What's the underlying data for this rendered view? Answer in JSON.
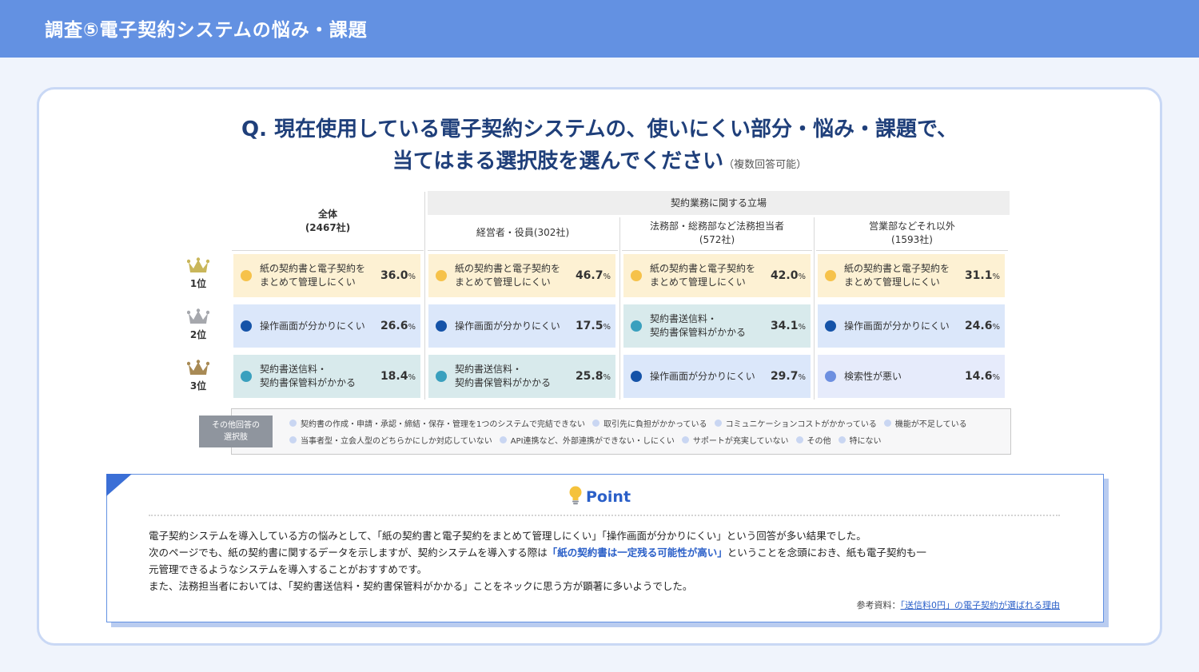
{
  "header": {
    "title": "調査⑤電子契約システムの悩み・課題"
  },
  "question": {
    "line1": "Q. 現在使用している電子契約システムの、使いにくい部分・悩み・課題で、",
    "line2": "当てはまる選択肢を選んでください",
    "note": "（複数回答可能）"
  },
  "table": {
    "all_header": {
      "name": "全体",
      "count": "(2467社)"
    },
    "group_header": "契約業務に関する立場",
    "columns": [
      {
        "name": "経営者・役員(302社)",
        "count": ""
      },
      {
        "name": "法務部・総務部など法務担当者",
        "count": "(572社)"
      },
      {
        "name": "営業部などそれ以外",
        "count": "(1593社)"
      }
    ],
    "ranks": [
      "1位",
      "2位",
      "3位"
    ],
    "cells": [
      [
        {
          "line1": "紙の契約書と電子契約を",
          "line2": "まとめて管理しにくい",
          "value": "36.0",
          "unit": "%",
          "bg": "#fdf1d3",
          "dot": "#f6c24a"
        },
        {
          "line1": "紙の契約書と電子契約を",
          "line2": "まとめて管理しにくい",
          "value": "46.7",
          "unit": "%",
          "bg": "#fdf1d3",
          "dot": "#f6c24a"
        },
        {
          "line1": "紙の契約書と電子契約を",
          "line2": "まとめて管理しにくい",
          "value": "42.0",
          "unit": "%",
          "bg": "#fdf1d3",
          "dot": "#f6c24a"
        },
        {
          "line1": "紙の契約書と電子契約を",
          "line2": "まとめて管理しにくい",
          "value": "31.1",
          "unit": "%",
          "bg": "#fdf1d3",
          "dot": "#f6c24a"
        }
      ],
      [
        {
          "line1": "操作画面が分かりにくい",
          "line2": "",
          "value": "26.6",
          "unit": "%",
          "bg": "#dbe7fa",
          "dot": "#1553a8"
        },
        {
          "line1": "操作画面が分かりにくい",
          "line2": "",
          "value": "17.5",
          "unit": "%",
          "bg": "#dbe7fa",
          "dot": "#1553a8"
        },
        {
          "line1": "契約書送信料・",
          "line2": "契約書保管料がかかる",
          "value": "34.1",
          "unit": "%",
          "bg": "#d8eaec",
          "dot": "#3aa0be"
        },
        {
          "line1": "操作画面が分かりにくい",
          "line2": "",
          "value": "24.6",
          "unit": "%",
          "bg": "#dbe7fa",
          "dot": "#1553a8"
        }
      ],
      [
        {
          "line1": "契約書送信料・",
          "line2": "契約書保管料がかかる",
          "value": "18.4",
          "unit": "%",
          "bg": "#d8eaec",
          "dot": "#3aa0be"
        },
        {
          "line1": "契約書送信料・",
          "line2": "契約書保管料がかかる",
          "value": "25.8",
          "unit": "%",
          "bg": "#d8eaec",
          "dot": "#3aa0be"
        },
        {
          "line1": "操作画面が分かりにくい",
          "line2": "",
          "value": "29.7",
          "unit": "%",
          "bg": "#dbe7fa",
          "dot": "#1553a8"
        },
        {
          "line1": "検索性が悪い",
          "line2": "",
          "value": "14.6",
          "unit": "%",
          "bg": "#e6ebfb",
          "dot": "#6d8fe0"
        }
      ]
    ]
  },
  "others": {
    "tag_line1": "その他回答の",
    "tag_line2": "選択肢",
    "row1": [
      "契約書の作成・申請・承認・締結・保存・管理を1つのシステムで完結できない",
      "取引先に負担がかかっている",
      "コミュニケーションコストがかかっている",
      "機能が不足している"
    ],
    "row2": [
      "当事者型・立会人型のどちらかにしか対応していない",
      "API連携など、外部連携ができない・しにくい",
      "サポートが充実していない",
      "その他",
      "特にない"
    ]
  },
  "point": {
    "title": "Point",
    "p1": "電子契約システムを導入している方の悩みとして、「紙の契約書と電子契約をまとめて管理しにくい」「操作画面が分かりにくい」という回答が多い結果でした。",
    "p2_pre": "次のページでも、紙の契約書に関するデータを示しますが、契約システムを導入する際は",
    "p2_hl": "「紙の契約書は一定残る可能性が高い」",
    "p2_post": "ということを念頭におき、紙も電子契約も一",
    "p3": "元管理できるようなシステムを導入することがおすすめです。",
    "p4": "また、法務担当者においては、「契約書送信料・契約書保管料がかかる」ことをネックに思う方が顕著に多いようでした。",
    "ref_label": "参考資料：",
    "ref_link": "「送信料0円」の電子契約が選ばれる理由"
  },
  "colors": {
    "header_bg": "#6391e2",
    "question": "#1f3f7a",
    "accent": "#2a5fc8"
  }
}
